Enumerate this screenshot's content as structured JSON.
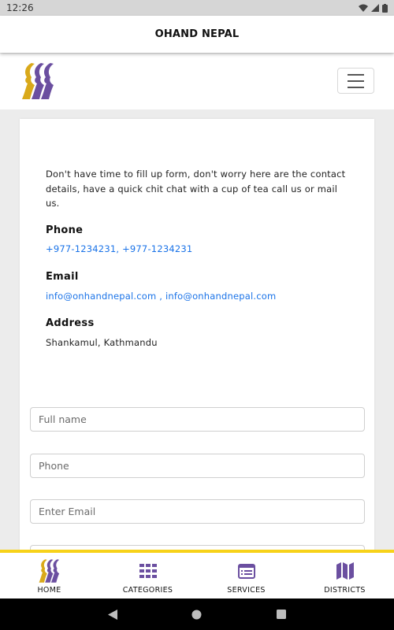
{
  "status_bar": {
    "time": "12:26"
  },
  "app_bar": {
    "title": "OHAND NEPAL"
  },
  "header": {
    "logo_icon": "ohand-logo-faces-icon",
    "menu_icon": "hamburger-menu-icon"
  },
  "contact": {
    "intro": "Don't have time to fill up form, don't worry here are the contact details, have a quick chit chat with a cup of tea call us or mail us.",
    "phone_label": "Phone",
    "phone_value": "+977-1234231, +977-1234231",
    "email_label": "Email",
    "email_value": "info@onhandnepal.com , info@onhandnepal.com",
    "address_label": "Address",
    "address_value": "Shankamul, Kathmandu"
  },
  "form": {
    "fullname_placeholder": "Full name",
    "phone_placeholder": "Phone",
    "email_placeholder": "Enter Email"
  },
  "bottom_nav": {
    "items": [
      {
        "label": "HOME",
        "icon": "home-logo-icon"
      },
      {
        "label": "CATEGORIES",
        "icon": "grid-icon"
      },
      {
        "label": "SERVICES",
        "icon": "list-window-icon"
      },
      {
        "label": "DISTRICTS",
        "icon": "map-icon"
      }
    ]
  },
  "colors": {
    "accent_yellow": "#f7d21a",
    "accent_purple": "#6b4fa0",
    "logo_gold": "#d9a91a",
    "link_blue": "#1a73e8"
  }
}
